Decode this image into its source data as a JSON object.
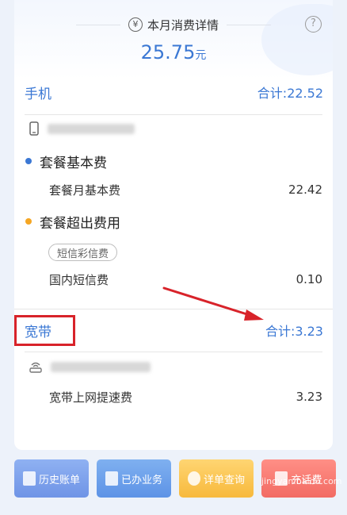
{
  "header": {
    "title": "本月消费详情",
    "total_value": "25.75",
    "total_unit": "元",
    "help_symbol": "?",
    "yen_symbol": "¥"
  },
  "sections": {
    "mobile": {
      "name": "手机",
      "sum": "合计:22.52",
      "categories": [
        {
          "title": "套餐基本费",
          "dot_color": "#3b78d4",
          "items": [
            {
              "label": "套餐月基本费",
              "value": "22.42"
            }
          ]
        },
        {
          "title": "套餐超出费用",
          "dot_color": "#f5a623",
          "tag": "短信彩信费",
          "items": [
            {
              "label": "国内短信费",
              "value": "0.10"
            }
          ]
        }
      ]
    },
    "broadband": {
      "name": "宽带",
      "sum": "合计:3.23",
      "items": [
        {
          "label": "宽带上网提速费",
          "value": "3.23"
        }
      ]
    }
  },
  "buttons": {
    "history": "历史账单",
    "done": "已办业务",
    "detail": "详单查询",
    "recharge": "充话费"
  },
  "watermark": "jingyan.baidu.com",
  "colors": {
    "accent": "#3b78d4",
    "annotation": "#d8232a"
  }
}
